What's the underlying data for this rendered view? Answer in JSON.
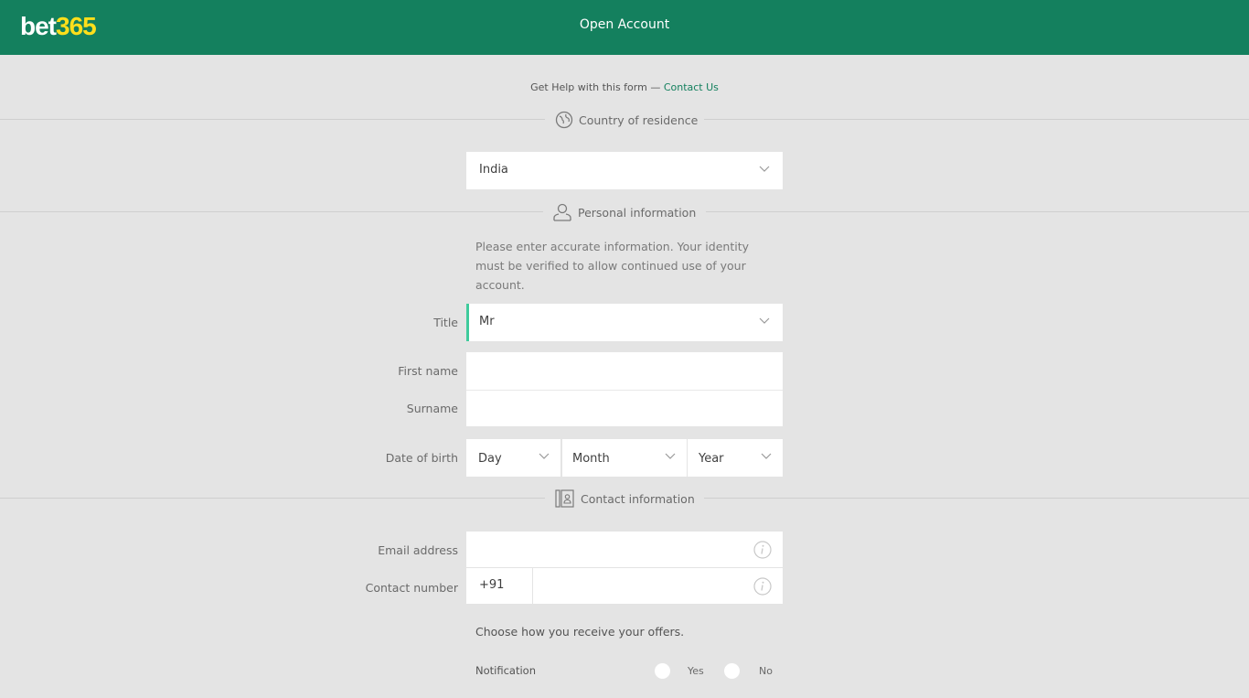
{
  "header": {
    "logo_part1": "bet",
    "logo_part2": "365",
    "title": "Open Account",
    "brand_color": "#14805e",
    "logo_accent_color": "#ffdf1b"
  },
  "help": {
    "text": "Get Help with this form —",
    "link": "Contact Us"
  },
  "sections": {
    "country": {
      "label": "Country of residence",
      "icon": "globe-icon"
    },
    "personal": {
      "label": "Personal information",
      "icon": "user-icon"
    },
    "contact": {
      "label": "Contact information",
      "icon": "address-book-icon"
    }
  },
  "country": {
    "value": "India"
  },
  "personal": {
    "intro": "Please enter accurate information. Your identity must be verified to allow continued use of your account.",
    "title_label": "Title",
    "title_value": "Mr",
    "first_name_label": "First name",
    "first_name_value": "",
    "surname_label": "Surname",
    "surname_value": "",
    "dob_label": "Date of birth",
    "dob_day": "Day",
    "dob_month": "Month",
    "dob_year": "Year"
  },
  "contact": {
    "email_label": "Email address",
    "email_value": "",
    "phone_label": "Contact number",
    "phone_prefix": "+91",
    "phone_value": ""
  },
  "offers": {
    "text": "Choose how you receive your offers.",
    "notification_label": "Notification",
    "yes_label": "Yes",
    "no_label": "No",
    "selected": null
  }
}
